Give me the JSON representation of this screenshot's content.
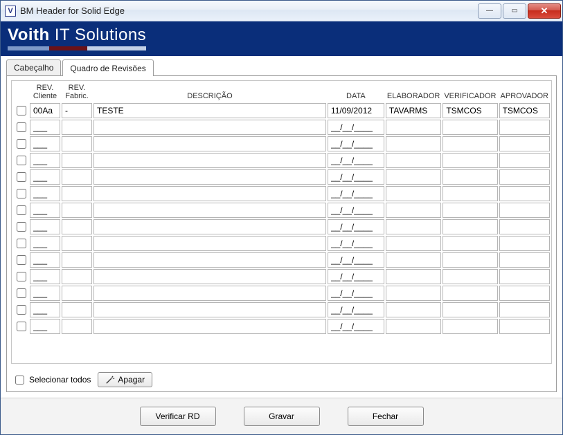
{
  "window": {
    "title": "BM Header for Solid Edge",
    "app_icon_letter": "V"
  },
  "banner": {
    "brand_strong": "Voith",
    "brand_light": "IT Solutions"
  },
  "tabs": [
    {
      "label": "Cabeçalho",
      "active": false
    },
    {
      "label": "Quadro de Revisões",
      "active": true
    }
  ],
  "columns": {
    "chk": "",
    "rev_cliente_l1": "REV.",
    "rev_cliente_l2": "Cliente",
    "rev_fabric_l1": "REV.",
    "rev_fabric_l2": "Fabric.",
    "descricao": "DESCRIÇÃO",
    "data": "DATA",
    "elaborador": "ELABORADOR",
    "verificador": "VERIFICADOR",
    "aprovador": "APROVADOR"
  },
  "rows": [
    {
      "chk": false,
      "rev_cliente": "00Aa",
      "rev_fabric": "-",
      "descricao": "TESTE",
      "data": "11/09/2012",
      "elaborador": "TAVARMS",
      "verificador": "TSMCOS",
      "aprovador": "TSMCOS"
    },
    {
      "chk": false,
      "rev_cliente": "___",
      "rev_fabric": "",
      "descricao": "",
      "data": "__/__/____",
      "elaborador": "",
      "verificador": "",
      "aprovador": ""
    },
    {
      "chk": false,
      "rev_cliente": "___",
      "rev_fabric": "",
      "descricao": "",
      "data": "__/__/____",
      "elaborador": "",
      "verificador": "",
      "aprovador": ""
    },
    {
      "chk": false,
      "rev_cliente": "___",
      "rev_fabric": "",
      "descricao": "",
      "data": "__/__/____",
      "elaborador": "",
      "verificador": "",
      "aprovador": ""
    },
    {
      "chk": false,
      "rev_cliente": "___",
      "rev_fabric": "",
      "descricao": "",
      "data": "__/__/____",
      "elaborador": "",
      "verificador": "",
      "aprovador": ""
    },
    {
      "chk": false,
      "rev_cliente": "___",
      "rev_fabric": "",
      "descricao": "",
      "data": "__/__/____",
      "elaborador": "",
      "verificador": "",
      "aprovador": ""
    },
    {
      "chk": false,
      "rev_cliente": "___",
      "rev_fabric": "",
      "descricao": "",
      "data": "__/__/____",
      "elaborador": "",
      "verificador": "",
      "aprovador": ""
    },
    {
      "chk": false,
      "rev_cliente": "___",
      "rev_fabric": "",
      "descricao": "",
      "data": "__/__/____",
      "elaborador": "",
      "verificador": "",
      "aprovador": ""
    },
    {
      "chk": false,
      "rev_cliente": "___",
      "rev_fabric": "",
      "descricao": "",
      "data": "__/__/____",
      "elaborador": "",
      "verificador": "",
      "aprovador": ""
    },
    {
      "chk": false,
      "rev_cliente": "___",
      "rev_fabric": "",
      "descricao": "",
      "data": "__/__/____",
      "elaborador": "",
      "verificador": "",
      "aprovador": ""
    },
    {
      "chk": false,
      "rev_cliente": "___",
      "rev_fabric": "",
      "descricao": "",
      "data": "__/__/____",
      "elaborador": "",
      "verificador": "",
      "aprovador": ""
    },
    {
      "chk": false,
      "rev_cliente": "___",
      "rev_fabric": "",
      "descricao": "",
      "data": "__/__/____",
      "elaborador": "",
      "verificador": "",
      "aprovador": ""
    },
    {
      "chk": false,
      "rev_cliente": "___",
      "rev_fabric": "",
      "descricao": "",
      "data": "__/__/____",
      "elaborador": "",
      "verificador": "",
      "aprovador": ""
    },
    {
      "chk": false,
      "rev_cliente": "___",
      "rev_fabric": "",
      "descricao": "",
      "data": "__/__/____",
      "elaborador": "",
      "verificador": "",
      "aprovador": ""
    }
  ],
  "panel_footer": {
    "select_all_label": "Selecionar todos",
    "delete_label": "Apagar"
  },
  "buttons": {
    "verify": "Verificar RD",
    "save": "Gravar",
    "close": "Fechar"
  }
}
